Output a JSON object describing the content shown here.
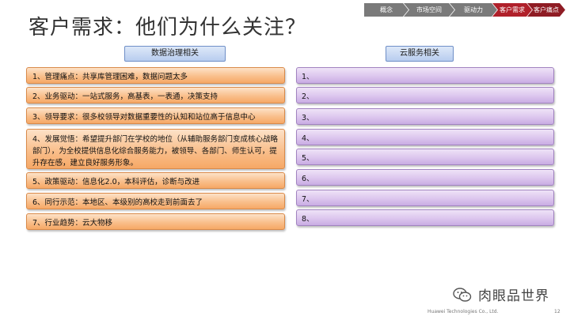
{
  "title": "客户需求：他们为什么关注？",
  "breadcrumb": [
    {
      "label": "概念",
      "state": "normal"
    },
    {
      "label": "市场空间",
      "state": "normal"
    },
    {
      "label": "驱动力",
      "state": "normal"
    },
    {
      "label": "客户需求",
      "state": "active"
    },
    {
      "label": "客户痛点",
      "state": "normal"
    }
  ],
  "left_header": "数据治理相关",
  "right_header": "云服务相关",
  "left_items": [
    "1、管理痛点：共享库管理困难，数据问题太多",
    "2、业务驱动：一站式服务，高基表，一表通，决策支持",
    "3、领导要求：很多校领导对数据重要性的认知和站位高于信息中心",
    "4、发展觉悟：希望提升部门在学校的地位（从辅助服务部门变成核心战略部门），为全校提供信息化综合服务能力，被领导、各部门、师生认可，提升存在感，建立良好服务形象。",
    "5、政策驱动：信息化2.0，本科评估，诊断与改进",
    "6、同行示范：本地区、本级别的高校走到前面去了",
    "7、行业趋势：云大物移"
  ],
  "right_items": [
    "1、",
    "2、",
    "3、",
    "4、",
    "5、",
    "6、",
    "7、",
    "8、"
  ],
  "watermark": "肉眼品世界",
  "footer": "Huawei Technologies Co., Ltd.",
  "page_number": "12",
  "colors": {
    "active_crumb": "#b0202a",
    "crumb": "#7a7a7a",
    "left_item": "#f9bf8c",
    "right_item": "#dcc6ee",
    "header": "#b8cdef"
  }
}
